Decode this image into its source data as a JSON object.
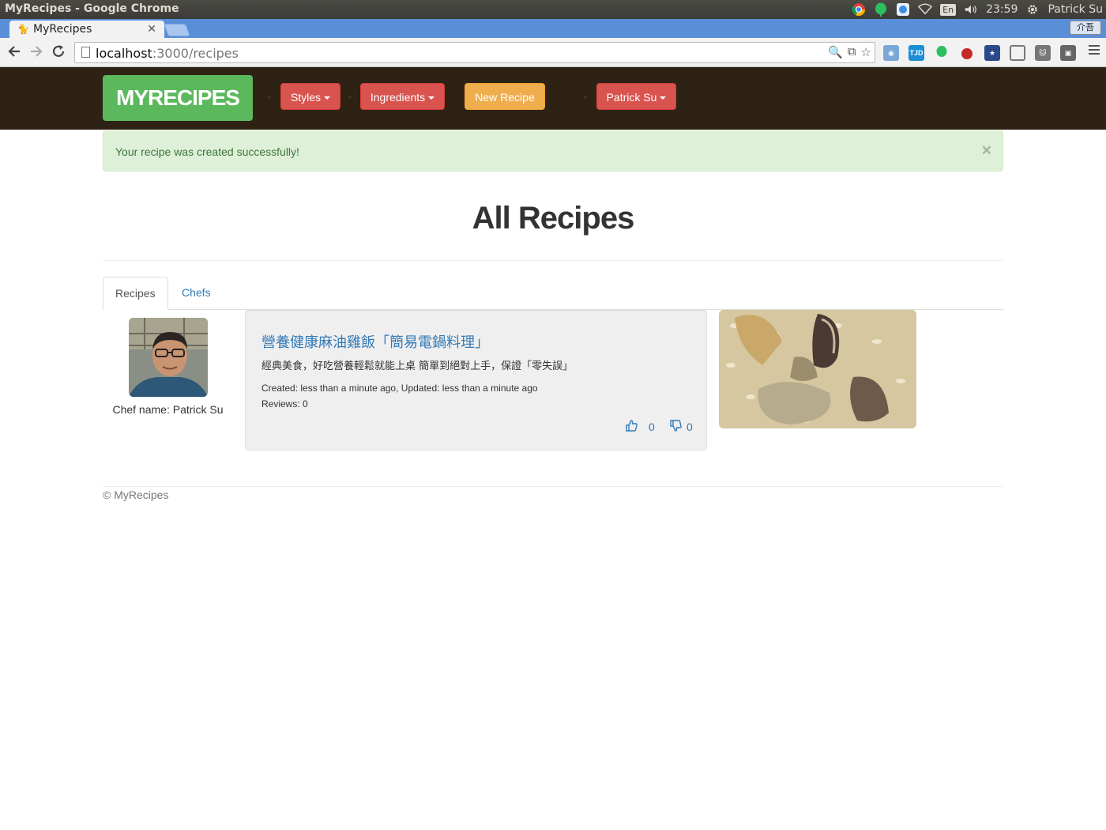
{
  "os": {
    "window_title": "MyRecipes - Google Chrome",
    "lang": "En",
    "time": "23:59",
    "user": "Patrick Su"
  },
  "browser": {
    "tab_title": "MyRecipes",
    "ime_label": "介吾",
    "url_host": "localhost",
    "url_rest": ":3000/recipes"
  },
  "navbar": {
    "brand": "MYRECIPES",
    "styles_label": "Styles",
    "ingredients_label": "Ingredients",
    "new_recipe_label": "New Recipe",
    "user_label": "Patrick Su",
    "colors": {
      "bar": "#2e2215",
      "brand": "#5cb85c",
      "danger": "#d9534f",
      "warning": "#f0ad4e"
    }
  },
  "alert": {
    "message": "Your recipe was created successfully!",
    "close": "×"
  },
  "page": {
    "title": "All Recipes"
  },
  "tabs": [
    {
      "label": "Recipes",
      "active": true
    },
    {
      "label": "Chefs",
      "active": false
    }
  ],
  "recipe": {
    "chef_name": "Chef name: Patrick Su",
    "title": "營養健康麻油雞飯「簡易電鍋料理」",
    "summary": "經典美食，好吃營養輕鬆就能上桌 簡單到絕對上手，保證「零失誤」",
    "meta": "Created: less than a minute ago, Updated: less than a minute ago",
    "reviews": "Reviews: 0",
    "likes": "0",
    "dislikes": "0"
  },
  "footer": {
    "text": "© MyRecipes"
  }
}
